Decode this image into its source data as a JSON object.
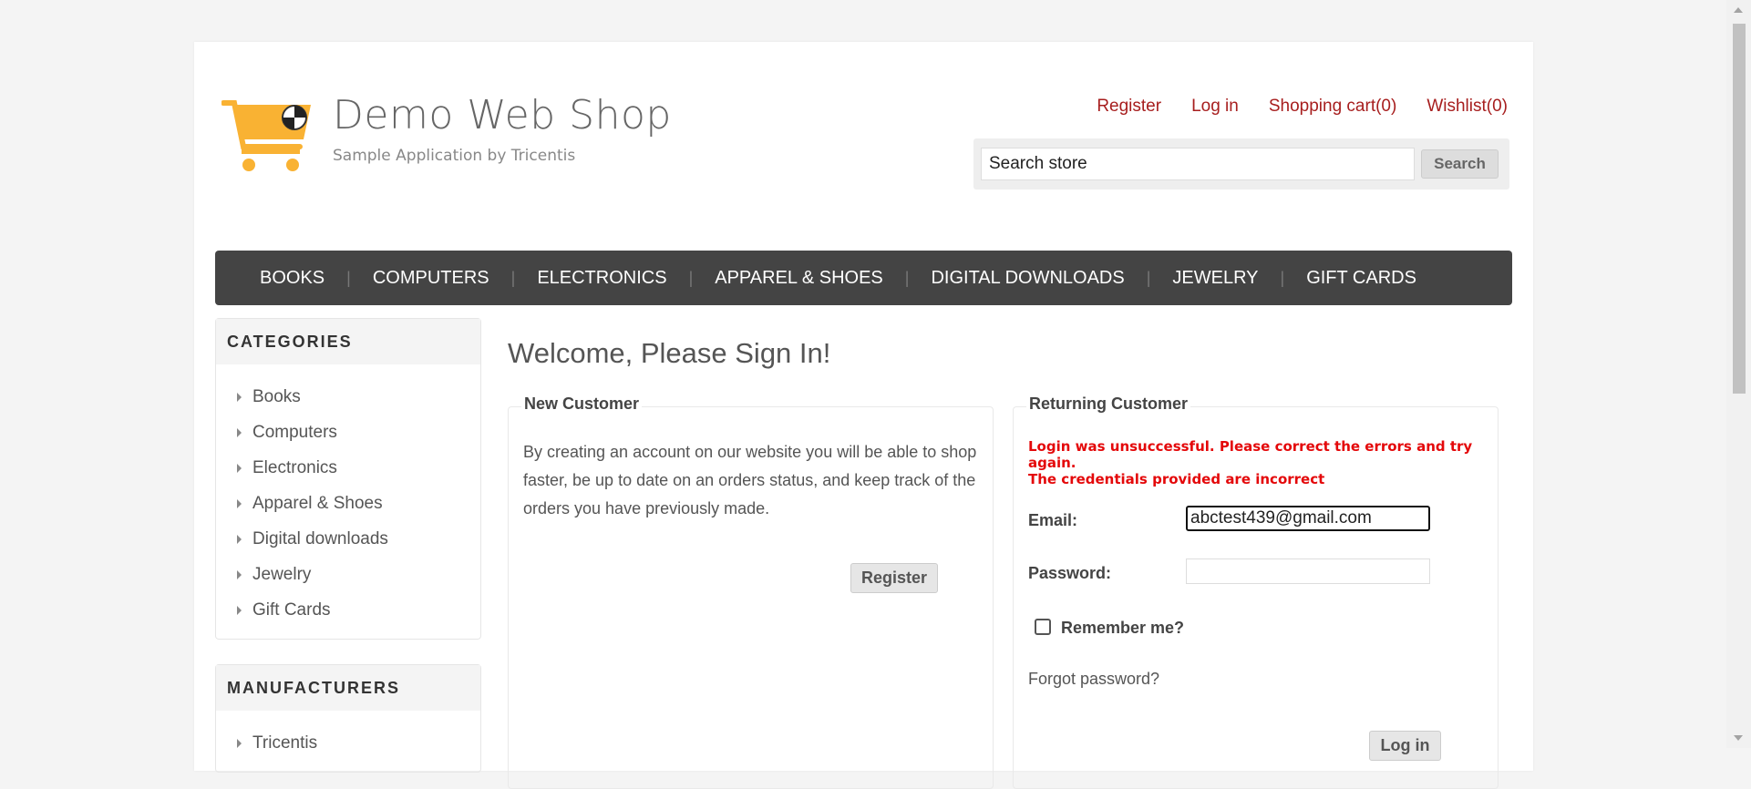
{
  "header": {
    "logo_title": "Demo Web Shop",
    "logo_subtitle": "Sample Application by Tricentis",
    "links": {
      "register": "Register",
      "login": "Log in",
      "cart": "Shopping cart(0)",
      "wishlist": "Wishlist(0)"
    },
    "search": {
      "value": "Search store",
      "button": "Search"
    }
  },
  "menu": [
    "BOOKS",
    "COMPUTERS",
    "ELECTRONICS",
    "APPAREL & SHOES",
    "DIGITAL DOWNLOADS",
    "JEWELRY",
    "GIFT CARDS"
  ],
  "sidebar": {
    "categories_title": "CATEGORIES",
    "categories": [
      "Books",
      "Computers",
      "Electronics",
      "Apparel & Shoes",
      "Digital downloads",
      "Jewelry",
      "Gift Cards"
    ],
    "manufacturers_title": "MANUFACTURERS",
    "manufacturers": [
      "Tricentis"
    ]
  },
  "main": {
    "title": "Welcome, Please Sign In!",
    "new_customer": {
      "legend": "New Customer",
      "text": "By creating an account on our website you will be able to shop faster, be up to date on an orders status, and keep track of the orders you have previously made.",
      "register_button": "Register"
    },
    "returning_customer": {
      "legend": "Returning Customer",
      "error_line1": "Login was unsuccessful. Please correct the errors and try again.",
      "error_line2": "The credentials provided are incorrect",
      "email_label": "Email:",
      "email_value": "abctest439@gmail.com",
      "password_label": "Password:",
      "password_value": "",
      "remember_label": "Remember me?",
      "forgot_link": "Forgot password?",
      "login_button": "Log in"
    }
  },
  "colors": {
    "link": "#a71e1e",
    "menu_bg": "#444444",
    "error": "#e4080a",
    "logo_orange": "#f9b233"
  }
}
